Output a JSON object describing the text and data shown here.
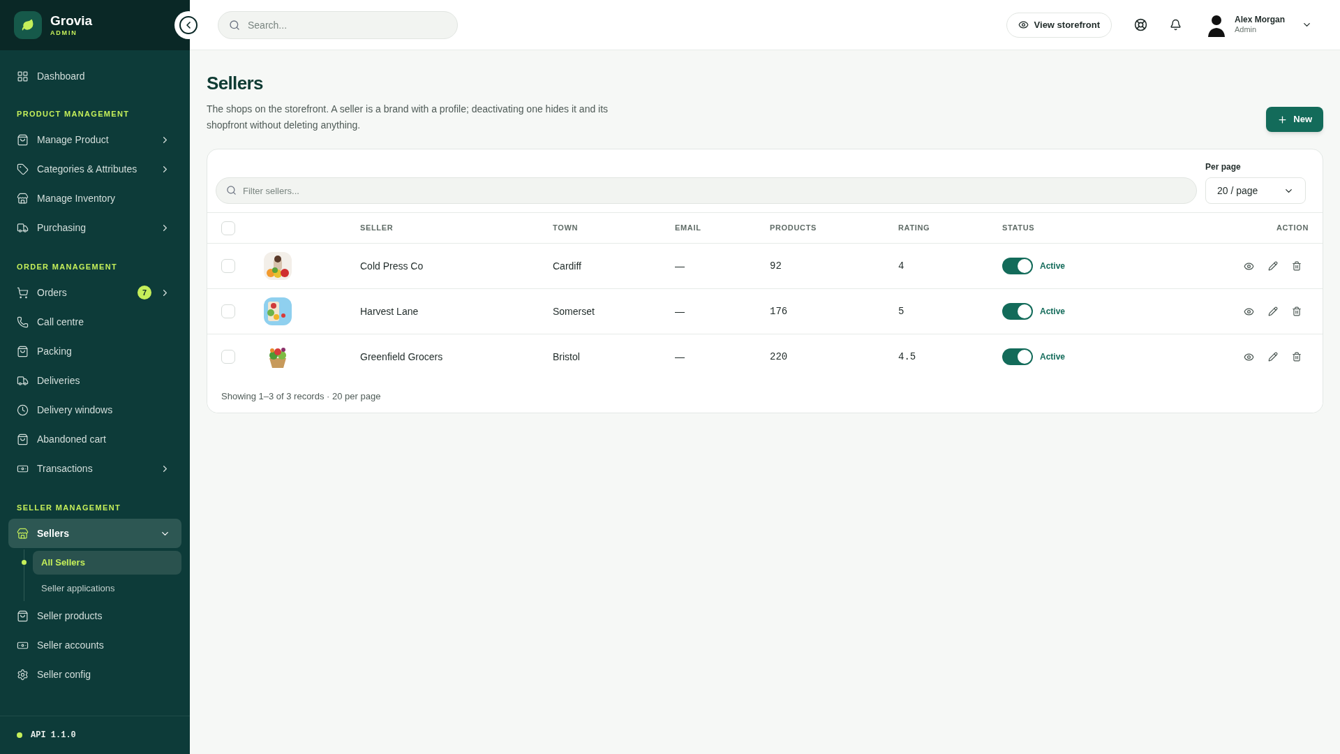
{
  "brand": {
    "name": "Grovia",
    "subtitle": "ADMIN"
  },
  "sidebar": {
    "sections": [
      {
        "items": [
          {
            "label": "Dashboard",
            "has_submenu": false,
            "expanded": false,
            "selected": false
          }
        ]
      },
      {
        "heading": "PRODUCT MANAGEMENT",
        "items": [
          {
            "label": "Manage Product",
            "has_submenu": true,
            "expanded": false,
            "selected": false
          },
          {
            "label": "Categories & Attributes",
            "has_submenu": true,
            "expanded": false,
            "selected": false
          },
          {
            "label": "Manage Inventory",
            "has_submenu": false,
            "expanded": false,
            "selected": false
          },
          {
            "label": "Purchasing",
            "has_submenu": true,
            "expanded": false,
            "selected": false
          }
        ]
      },
      {
        "heading": "ORDER MANAGEMENT",
        "items": [
          {
            "label": "Orders",
            "badge": "7",
            "has_submenu": true,
            "expanded": false,
            "selected": false
          },
          {
            "label": "Call centre",
            "has_submenu": false,
            "expanded": false,
            "selected": false
          },
          {
            "label": "Packing",
            "has_submenu": false,
            "expanded": false,
            "selected": false
          },
          {
            "label": "Deliveries",
            "has_submenu": false,
            "expanded": false,
            "selected": false
          },
          {
            "label": "Delivery windows",
            "has_submenu": false,
            "expanded": false,
            "selected": false
          },
          {
            "label": "Abandoned cart",
            "has_submenu": false,
            "expanded": false,
            "selected": false
          },
          {
            "label": "Transactions",
            "has_submenu": true,
            "expanded": false,
            "selected": false
          }
        ]
      },
      {
        "heading": "SELLER MANAGEMENT",
        "items": [
          {
            "label": "Sellers",
            "has_submenu": true,
            "expanded": true,
            "selected": true,
            "children": [
              {
                "label": "All Sellers",
                "selected": true
              },
              {
                "label": "Seller applications",
                "selected": false
              }
            ]
          },
          {
            "label": "Seller products",
            "has_submenu": false,
            "expanded": false,
            "selected": false
          },
          {
            "label": "Seller accounts",
            "has_submenu": false,
            "expanded": false,
            "selected": false
          },
          {
            "label": "Seller config",
            "has_submenu": false,
            "expanded": false,
            "selected": false
          }
        ]
      }
    ]
  },
  "footer": {
    "version": "API 1.1.0"
  },
  "header": {
    "search": {
      "placeholder": "Search..."
    },
    "storefront_button": "View storefront",
    "user": {
      "name": "Alex Morgan",
      "role": "Admin"
    }
  },
  "page": {
    "title": "Sellers",
    "description": "The shops on the storefront. A seller is a brand with a profile; deactivating one hides it and its shopfront without deleting anything.",
    "new_button": "New"
  },
  "table": {
    "filter": {
      "placeholder": "Filter sellers..."
    },
    "per_page": {
      "label": "Per page",
      "value": "20 / page"
    },
    "select_all": {
      "checked": false
    },
    "columns": [
      "SELLER",
      "TOWN",
      "EMAIL",
      "PRODUCTS",
      "RATING",
      "STATUS",
      "ACTION"
    ],
    "rows": [
      {
        "checked": false,
        "seller": "Cold Press Co",
        "town": "Cardiff",
        "email": "—",
        "products": "92",
        "rating": "4",
        "active": true,
        "status": "Active"
      },
      {
        "checked": false,
        "seller": "Harvest Lane",
        "town": "Somerset",
        "email": "—",
        "products": "176",
        "rating": "5",
        "active": true,
        "status": "Active"
      },
      {
        "checked": false,
        "seller": "Greenfield Grocers",
        "town": "Bristol",
        "email": "—",
        "products": "220",
        "rating": "4.5",
        "active": true,
        "status": "Active"
      }
    ],
    "summary": "Showing 1–3 of 3 records · 20 per page"
  }
}
